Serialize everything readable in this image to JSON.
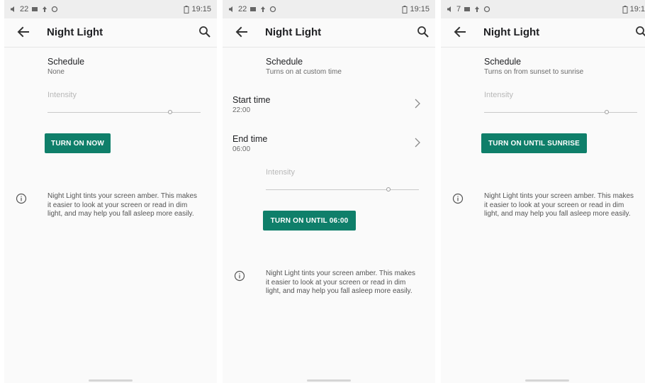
{
  "common": {
    "title": "Night Light",
    "intensity_label": "Intensity",
    "schedule_label": "Schedule",
    "info_text": "Night Light tints your screen amber. This makes it easier to look at your screen or read in dim light, and may help you fall asleep more easily.",
    "accent_color": "#0f7f6a",
    "icons": {
      "back": "arrow-left-icon",
      "search": "search-icon",
      "info": "info-icon",
      "chevron": "chevron-right-icon"
    }
  },
  "panels": [
    {
      "status": {
        "left": "22",
        "time": "19:15"
      },
      "schedule_value": "None",
      "button_label": "TURN ON NOW",
      "intensity_level": 0.8
    },
    {
      "status": {
        "left": "22",
        "time": "19:15"
      },
      "schedule_value": "Turns on at custom time",
      "start_time": {
        "label": "Start time",
        "value": "22:00"
      },
      "end_time": {
        "label": "End time",
        "value": "06:00"
      },
      "button_label": "TURN ON UNTIL 06:00",
      "intensity_level": 0.8
    },
    {
      "status": {
        "left": "7",
        "time": "19:1"
      },
      "schedule_value": "Turns on from sunset to sunrise",
      "button_label": "TURN ON UNTIL SUNRISE",
      "intensity_level": 0.8
    }
  ]
}
